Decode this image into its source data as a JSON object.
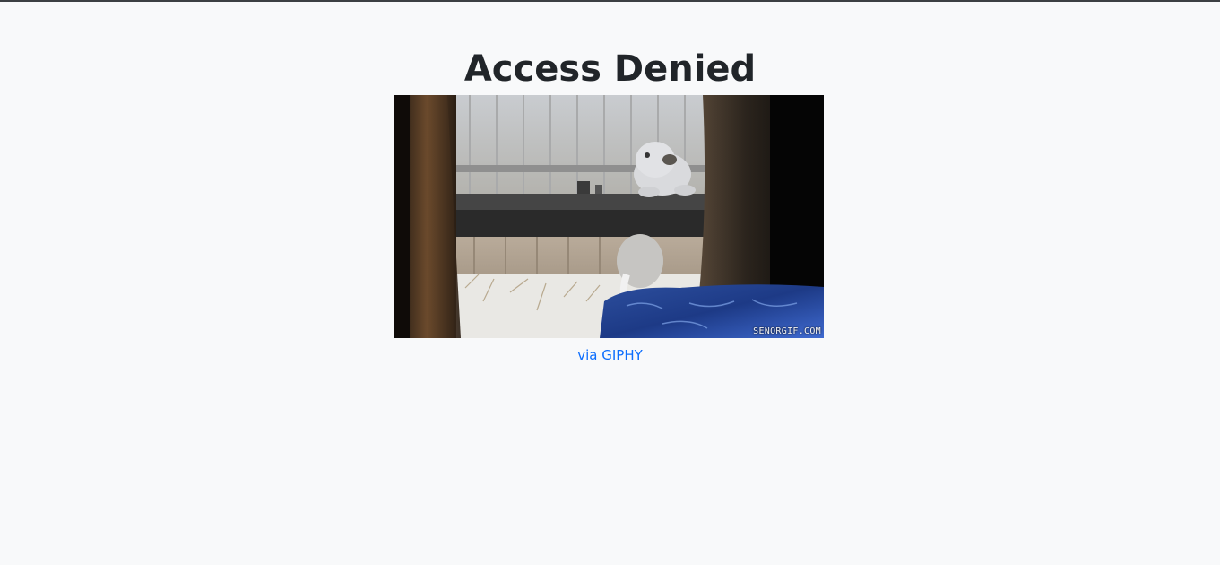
{
  "page": {
    "heading": "Access Denied",
    "image_watermark": "SENORGIF.COM",
    "link_text": "via GIPHY"
  },
  "colors": {
    "background": "#f8f9fa",
    "heading": "#212529",
    "link": "#0d6efd"
  }
}
